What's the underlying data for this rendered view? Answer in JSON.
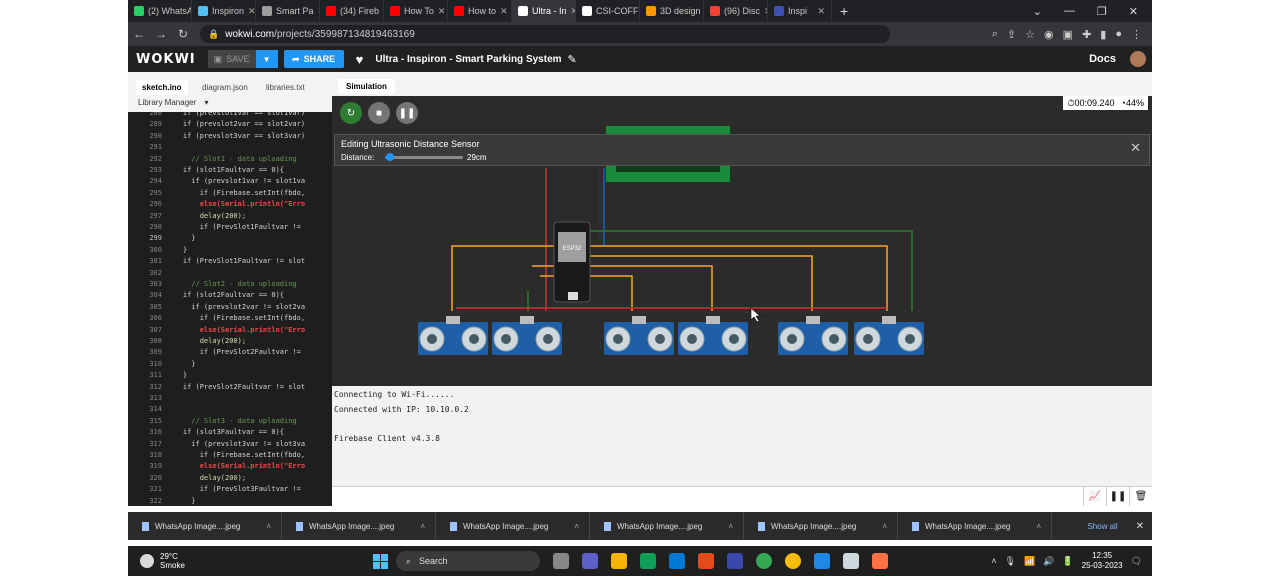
{
  "browser": {
    "tabs": [
      {
        "label": "(2) WhatsA",
        "color": "#25d366"
      },
      {
        "label": "Inspiron",
        "color": "#4fc3f7"
      },
      {
        "label": "Smart Pa",
        "color": "#9e9e9e"
      },
      {
        "label": "(34) Fireb",
        "color": "#ff0000"
      },
      {
        "label": "How To",
        "color": "#ff0000"
      },
      {
        "label": "How to",
        "color": "#ff0000"
      },
      {
        "label": "Ultra - In",
        "color": "#ffffff",
        "active": true
      },
      {
        "label": "CSI-COFF",
        "color": "#ffffff"
      },
      {
        "label": "3D design",
        "color": "#ff9800"
      },
      {
        "label": "(96) Disc",
        "color": "#f44336"
      },
      {
        "label": "Inspi",
        "color": "#3f51b5"
      }
    ],
    "url_host": "wokwi.com",
    "url_path": "/projects/359987134819463169"
  },
  "header": {
    "logo": "WOKWI",
    "save_label": "SAVE",
    "share_label": "SHARE",
    "project_title": "Ultra - Inspiron - Smart Parking System",
    "docs_label": "Docs"
  },
  "editor": {
    "tabs": [
      "sketch.ino",
      "diagram.json",
      "libraries.txt"
    ],
    "library_manager": "Library Manager",
    "lines": [
      {
        "n": "288",
        "code": "    if (prevslot1var == slot1var)"
      },
      {
        "n": "289",
        "code": "    if (prevslot2var == slot2var)"
      },
      {
        "n": "290",
        "code": "    if (prevslot3var == slot3var)"
      },
      {
        "n": "291",
        "code": ""
      },
      {
        "n": "292",
        "code": "      // Slot1 - data uploading"
      },
      {
        "n": "293",
        "code": "    if (slot1Faultvar == 0){"
      },
      {
        "n": "294",
        "code": "      if (prevslot1var != slot1va"
      },
      {
        "n": "295",
        "code": "        if (Firebase.setInt(fbdo,"
      },
      {
        "n": "296",
        "code": "        else(Serial.println(\"Erro"
      },
      {
        "n": "297",
        "code": "        delay(200);"
      },
      {
        "n": "298",
        "code": "        if (PrevSlot1Faultvar !="
      },
      {
        "n": "299",
        "code": "      }"
      },
      {
        "n": "300",
        "code": "    }"
      },
      {
        "n": "301",
        "code": "    if (PrevSlot1Faultvar != slot"
      },
      {
        "n": "302",
        "code": ""
      },
      {
        "n": "303",
        "code": "      // Slot2 - data uploading"
      },
      {
        "n": "304",
        "code": "    if (slot2Faultvar == 0){"
      },
      {
        "n": "305",
        "code": "      if (prevslot2var != slot2va"
      },
      {
        "n": "306",
        "code": "        if (Firebase.setInt(fbdo,"
      },
      {
        "n": "307",
        "code": "        else(Serial.println(\"Erro"
      },
      {
        "n": "308",
        "code": "        delay(200);"
      },
      {
        "n": "309",
        "code": "        if (PrevSlot2Faultvar !="
      },
      {
        "n": "310",
        "code": "      }"
      },
      {
        "n": "311",
        "code": "    }"
      },
      {
        "n": "312",
        "code": "    if (PrevSlot2Faultvar != slot"
      },
      {
        "n": "313",
        "code": ""
      },
      {
        "n": "314",
        "code": ""
      },
      {
        "n": "315",
        "code": "      // Slot3 - data uploading"
      },
      {
        "n": "316",
        "code": "    if (slot3Faultvar == 0){"
      },
      {
        "n": "317",
        "code": "      if (prevslot3var != slot3va"
      },
      {
        "n": "318",
        "code": "        if (Firebase.setInt(fbdo,"
      },
      {
        "n": "319",
        "code": "        else(Serial.println(\"Erro"
      },
      {
        "n": "320",
        "code": "        delay(200);"
      },
      {
        "n": "321",
        "code": "        if (PrevSlot3Faultvar !="
      },
      {
        "n": "322",
        "code": "      }"
      }
    ],
    "current_line": "299"
  },
  "simulation": {
    "tab_label": "Simulation",
    "timer": "00:09.240",
    "speed": "44%",
    "edit_panel": {
      "title": "Editing Ultrasonic Distance Sensor",
      "distance_label": "Distance:",
      "distance_value": "29cm",
      "distance_fraction": 0.07
    },
    "chip_label": "ESP32"
  },
  "serial": {
    "lines": [
      "Connecting to Wi-Fi......",
      "Connected with IP: 10.10.0.2",
      "",
      "Firebase Client v4.3.8"
    ]
  },
  "downloads": {
    "items": [
      "WhatsApp Image....jpeg",
      "WhatsApp Image....jpeg",
      "WhatsApp Image....jpeg",
      "WhatsApp Image....jpeg",
      "WhatsApp Image....jpeg",
      "WhatsApp Image....jpeg"
    ],
    "show_all": "Show all"
  },
  "taskbar": {
    "temperature": "29°C",
    "weather": "Smoke",
    "search": "Search",
    "time": "12:35",
    "date": "25-03-2023"
  }
}
